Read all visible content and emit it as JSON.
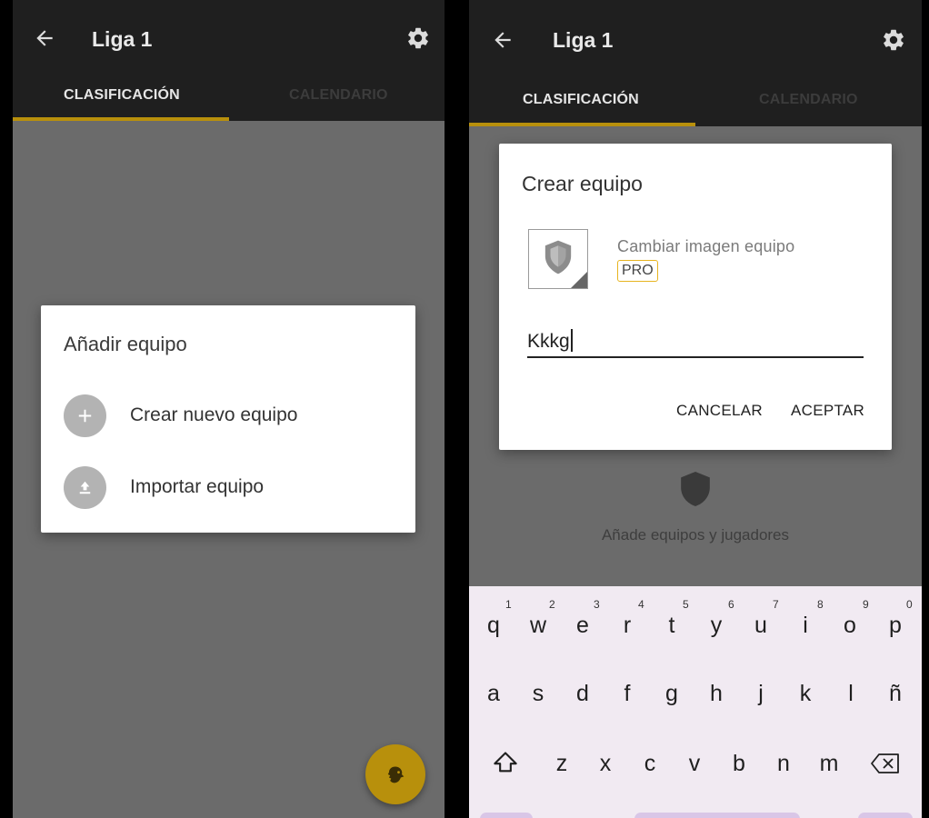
{
  "left": {
    "appbar": {
      "title": "Liga 1"
    },
    "tabs": {
      "active": "CLASIFICACIÓN",
      "inactive": "CALENDARIO"
    },
    "dialog": {
      "title": "Añadir equipo",
      "options": [
        {
          "label": "Crear nuevo equipo",
          "icon": "plus-icon"
        },
        {
          "label": "Importar equipo",
          "icon": "upload-icon"
        }
      ]
    },
    "fab": {
      "icon": "lion-icon"
    }
  },
  "right": {
    "appbar": {
      "title": "Liga 1"
    },
    "tabs": {
      "active": "CLASIFICACIÓN",
      "inactive": "CALENDARIO"
    },
    "empty_state": {
      "text": "Añade equipos y jugadores",
      "icon": "shield-icon"
    },
    "dialog": {
      "title": "Crear equipo",
      "change_image": "Cambiar imagen equipo",
      "pro_badge": "PRO",
      "team_name_value": "Kkkg",
      "cancel": "CANCELAR",
      "accept": "ACEPTAR"
    },
    "keyboard": {
      "row1": [
        "q",
        "w",
        "e",
        "r",
        "t",
        "y",
        "u",
        "i",
        "o",
        "p"
      ],
      "row1_hints": [
        "1",
        "2",
        "3",
        "4",
        "5",
        "6",
        "7",
        "8",
        "9",
        "0"
      ],
      "row2": [
        "a",
        "s",
        "d",
        "f",
        "g",
        "h",
        "j",
        "k",
        "l",
        "ñ"
      ],
      "row3": [
        "z",
        "x",
        "c",
        "v",
        "b",
        "n",
        "m"
      ]
    }
  },
  "colors": {
    "accent": "#b8900c",
    "toolbar": "#1f1f1f",
    "scrim": "#6b6b6b",
    "pro_border": "#e7b420",
    "keyboard_bg": "#f1eaf2"
  }
}
